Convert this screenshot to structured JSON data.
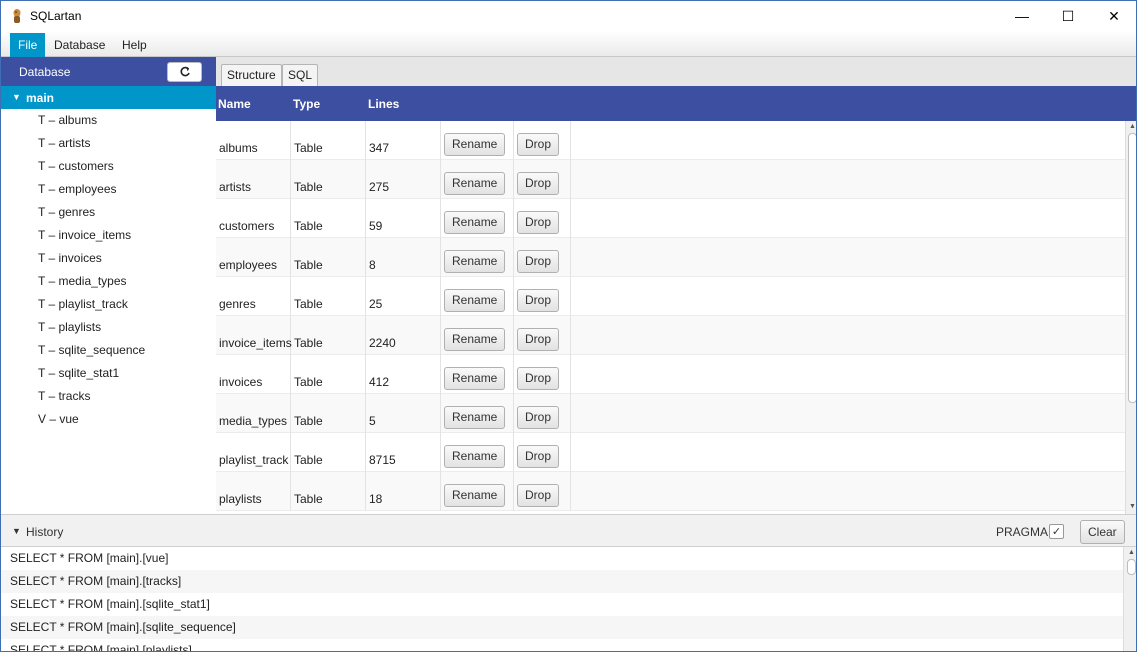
{
  "window": {
    "title": "SQLartan",
    "minimize_glyph": "—",
    "maximize_glyph": "☐",
    "close_glyph": "✕"
  },
  "menu": {
    "items": [
      "File",
      "Database",
      "Help"
    ],
    "active": "File"
  },
  "sidebar": {
    "title": "Database",
    "refresh_icon": "refresh-icon",
    "root": {
      "label": "main",
      "expanded": true
    },
    "items": [
      "T – albums",
      "T – artists",
      "T – customers",
      "T – employees",
      "T – genres",
      "T – invoice_items",
      "T – invoices",
      "T – media_types",
      "T – playlist_track",
      "T – playlists",
      "T – sqlite_sequence",
      "T – sqlite_stat1",
      "T – tracks",
      "V – vue"
    ]
  },
  "tabs": {
    "items": [
      "Structure",
      "SQL"
    ],
    "active": "Structure"
  },
  "table": {
    "columns": {
      "name": "Name",
      "type": "Type",
      "lines": "Lines"
    },
    "rename_label": "Rename",
    "drop_label": "Drop",
    "rows": [
      {
        "name": "albums",
        "type": "Table",
        "lines": "347"
      },
      {
        "name": "artists",
        "type": "Table",
        "lines": "275"
      },
      {
        "name": "customers",
        "type": "Table",
        "lines": "59"
      },
      {
        "name": "employees",
        "type": "Table",
        "lines": "8"
      },
      {
        "name": "genres",
        "type": "Table",
        "lines": "25"
      },
      {
        "name": "invoice_items",
        "type": "Table",
        "lines": "2240"
      },
      {
        "name": "invoices",
        "type": "Table",
        "lines": "412"
      },
      {
        "name": "media_types",
        "type": "Table",
        "lines": "5"
      },
      {
        "name": "playlist_track",
        "type": "Table",
        "lines": "8715"
      },
      {
        "name": "playlists",
        "type": "Table",
        "lines": "18"
      }
    ]
  },
  "history": {
    "title": "History",
    "pragma_label": "PRAGMA",
    "pragma_checked": true,
    "clear_label": "Clear",
    "entries": [
      "SELECT * FROM [main].[vue]",
      "SELECT * FROM [main].[tracks]",
      "SELECT * FROM [main].[sqlite_stat1]",
      "SELECT * FROM [main].[sqlite_sequence]",
      "SELECT * FROM [main].[playlists]"
    ]
  },
  "colors": {
    "header_blue": "#3c4fa0",
    "selection_blue": "#0096c9"
  }
}
